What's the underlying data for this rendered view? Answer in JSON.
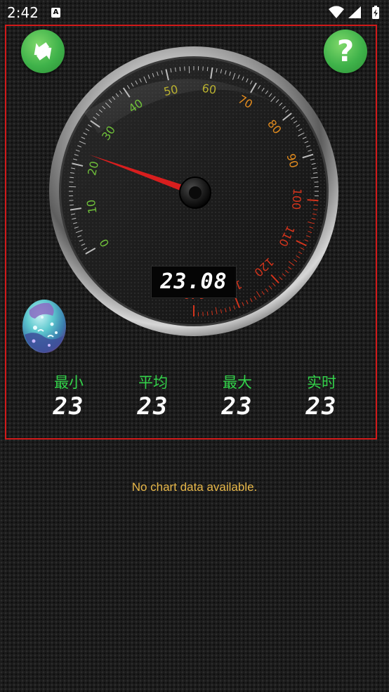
{
  "status_bar": {
    "time": "2:42",
    "notification_icon": "a-letter-icon",
    "icons": [
      "wifi-icon",
      "cellular-signal-icon",
      "battery-charging-icon"
    ]
  },
  "gauge": {
    "tick_labels": [
      "0",
      "10",
      "20",
      "30",
      "40",
      "50",
      "60",
      "70",
      "80",
      "90",
      "100",
      "110",
      "120",
      "130",
      "140"
    ],
    "needle_value": 23,
    "digital_readout": "23.08",
    "colors": {
      "low": "#6fbf3a",
      "mid": "#b8b030",
      "orange": "#e08a1e",
      "high": "#d4341c",
      "needle": "#d81e1e"
    }
  },
  "buttons": {
    "refresh_icon": "refresh-arrows-icon",
    "help_label": "?"
  },
  "stats": {
    "min": {
      "label": "最小",
      "value": "23"
    },
    "avg": {
      "label": "平均",
      "value": "23"
    },
    "max": {
      "label": "最大",
      "value": "23"
    },
    "now": {
      "label": "实时",
      "value": "23"
    }
  },
  "chart": {
    "empty_message": "No chart data available."
  },
  "theme": {
    "accent_green": "#33d24a",
    "panel_border": "#d11a1a",
    "message_color": "#e8b84a"
  }
}
